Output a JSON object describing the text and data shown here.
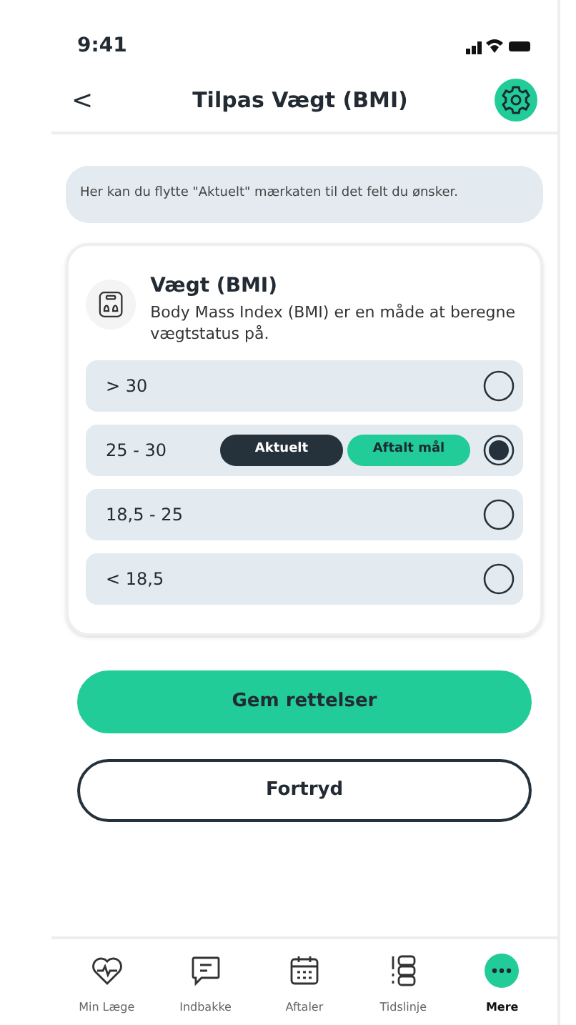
{
  "status_bar": {
    "time": "9:41"
  },
  "header": {
    "back": "<",
    "title": "Tilpas Vægt (BMI)"
  },
  "info": "Her kan du flytte \"Aktuelt\" mærkaten til det felt du ønsker.",
  "card": {
    "title": "Vægt (BMI)",
    "description": "Body Mass Index (BMI) er en måde at beregne vægtstatus på.",
    "rows": [
      {
        "label": "> 30",
        "selected": false,
        "tags": []
      },
      {
        "label": "25 - 30",
        "selected": true,
        "tags": [
          {
            "text": "Aktuelt",
            "kind": "current"
          },
          {
            "text": "Aftalt mål",
            "kind": "goal"
          }
        ]
      },
      {
        "label": "18,5 - 25",
        "selected": false,
        "tags": []
      },
      {
        "label": "< 18,5",
        "selected": false,
        "tags": []
      }
    ]
  },
  "buttons": [
    {
      "label": "Gem rettelser",
      "kind": "primary"
    },
    {
      "label": "Fortryd",
      "kind": "secondary"
    }
  ],
  "nav": [
    {
      "label": "Min Læge",
      "selected": false
    },
    {
      "label": "Indbakke",
      "selected": false
    },
    {
      "label": "Aftaler",
      "selected": false
    },
    {
      "label": "Tidslinje",
      "selected": false
    },
    {
      "label": "Mere",
      "selected": true
    }
  ]
}
